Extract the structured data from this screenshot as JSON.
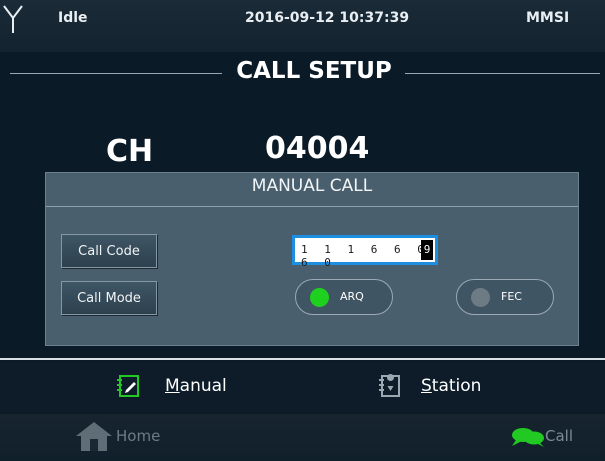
{
  "status": {
    "state": "Idle",
    "datetime": "2016-09-12 10:37:39",
    "mmsi_label": "MMSI"
  },
  "title": "CALL SETUP",
  "channel": {
    "label": "CH",
    "value": "04004"
  },
  "panel": {
    "title": "MANUAL CALL",
    "call_code_button": "Call Code",
    "call_mode_button": "Call Mode",
    "call_code_digits": "1 1 1 6 6 0 6 0",
    "call_code_cursor_digit": "9",
    "mode_options": [
      {
        "label": "ARQ",
        "selected": true
      },
      {
        "label": "FEC",
        "selected": false
      }
    ]
  },
  "mode_tabs": {
    "manual_prefix": "M",
    "manual_rest": "anual",
    "station_prefix": "S",
    "station_rest": "tation"
  },
  "nav": {
    "home_label": "Home",
    "call_label": "Call"
  },
  "icons": {
    "antenna": "antenna-icon",
    "manual": "manual-edit-icon",
    "station": "station-icon",
    "home": "home-icon",
    "call": "call-bubble-icon"
  },
  "colors": {
    "accent_blue": "#1e8fe0",
    "selected_green": "#1fd11f",
    "call_green": "#22c922",
    "inactive_grey": "#6d7b84"
  }
}
